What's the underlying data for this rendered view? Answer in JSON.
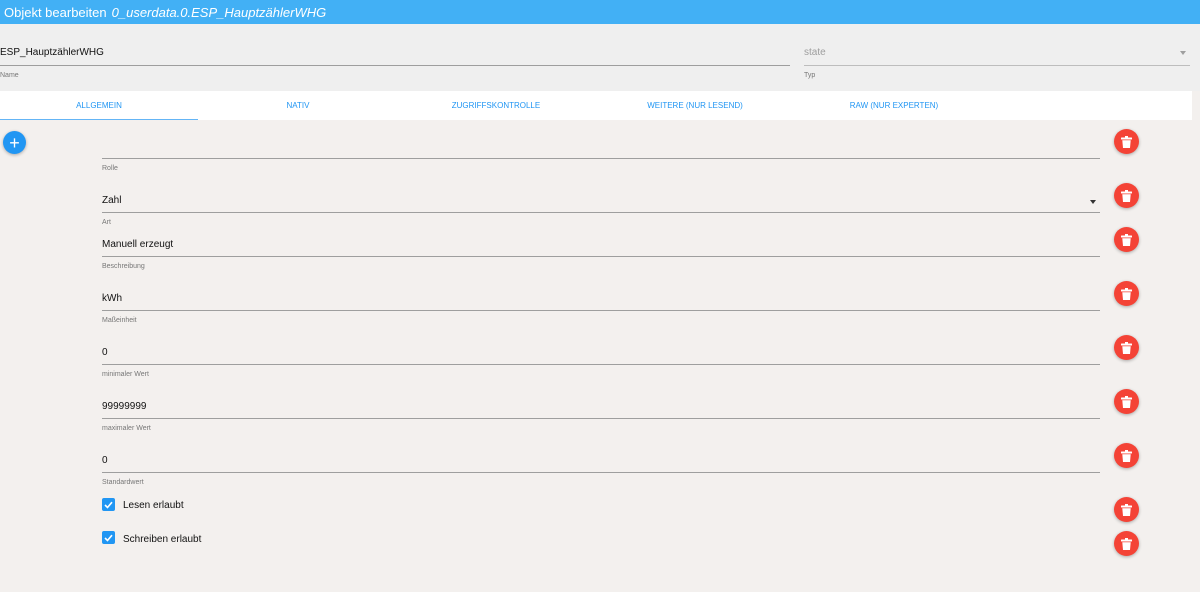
{
  "dialog": {
    "title": "Objekt bearbeiten",
    "object_id": "0_userdata.0.ESP_HauptzählerWHG"
  },
  "header": {
    "name_value": "ESP_HauptzählerWHG",
    "name_label": "Name",
    "type_value": "state",
    "type_label": "Typ"
  },
  "tabs": [
    {
      "label": "Allgemein",
      "active": true
    },
    {
      "label": "Nativ"
    },
    {
      "label": "Zugriffskontrolle"
    },
    {
      "label": "Weitere (nur lesend)"
    },
    {
      "label": "Raw (nur Experten)"
    }
  ],
  "fields": {
    "role": {
      "value": "",
      "label": "Rolle"
    },
    "kind": {
      "value": "Zahl",
      "label": "Art"
    },
    "description": {
      "value": "Manuell erzeugt",
      "label": "Beschreibung"
    },
    "unit": {
      "value": "kWh",
      "label": "Maßeinheit"
    },
    "min": {
      "value": "0",
      "label": "minimaler Wert"
    },
    "max": {
      "value": "99999999",
      "label": "maximaler Wert"
    },
    "default": {
      "value": "0",
      "label": "Standardwert"
    }
  },
  "checkboxes": {
    "read": {
      "label": "Lesen erlaubt",
      "checked": true
    },
    "write": {
      "label": "Schreiben erlaubt",
      "checked": true
    }
  },
  "icons": {
    "add": "plus-icon",
    "delete": "trash-icon",
    "dropdown": "caret-down-icon",
    "check": "checkmark-icon"
  },
  "colors": {
    "accent": "#2196f3",
    "titlebar": "#42b0f5",
    "danger": "#f44336"
  }
}
